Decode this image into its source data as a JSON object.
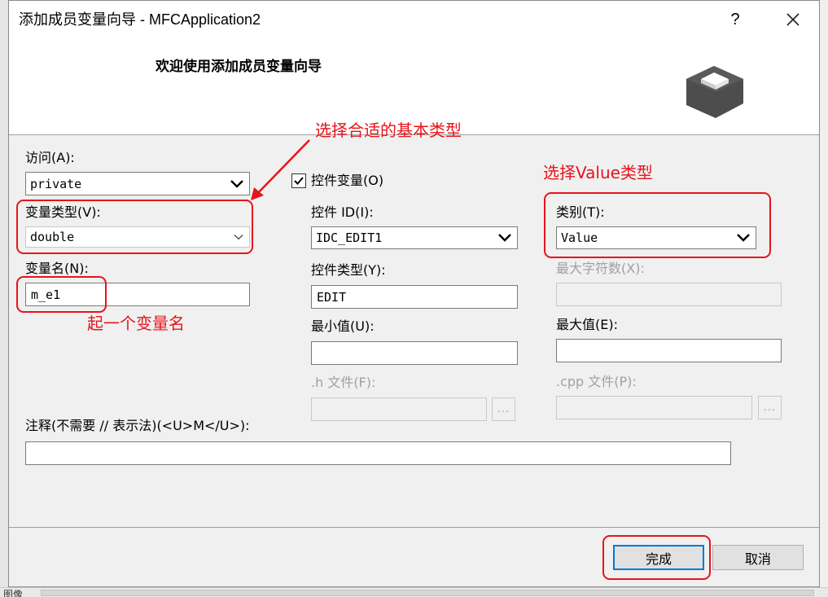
{
  "window": {
    "title": "添加成员变量向导 - MFCApplication2",
    "help_glyph": "?",
    "close_glyph": "✕"
  },
  "banner": {
    "heading": "欢迎使用添加成员变量向导"
  },
  "form": {
    "access_label": "访问(A):",
    "access_value": "private",
    "vartype_label": "变量类型(V):",
    "vartype_value": "double",
    "varname_label": "变量名(N):",
    "varname_value": "m_e1",
    "control_var_label": "控件变量(O)",
    "control_var_checked": true,
    "control_id_label": "控件 ID(I):",
    "control_id_value": "IDC_EDIT1",
    "control_type_label": "控件类型(Y):",
    "control_type_value": "EDIT",
    "min_label": "最小值(U):",
    "min_value": "",
    "h_file_label": ".h 文件(F):",
    "h_file_value": "",
    "category_label": "类别(T):",
    "category_value": "Value",
    "max_chars_label": "最大字符数(X):",
    "max_chars_value": "",
    "max_label": "最大值(E):",
    "max_value": "",
    "cpp_file_label": ".cpp 文件(P):",
    "cpp_file_value": "",
    "browse_label": "...",
    "comment_label": "注释(不需要 // 表示法)(<U>M</U>):",
    "comment_value": ""
  },
  "buttons": {
    "finish": "完成",
    "cancel": "取消"
  },
  "annotations": {
    "choose_basic_type": "选择合适的基本类型",
    "choose_value_type": "选择Value类型",
    "name_variable": "起一个变量名",
    "color": "#e8131b"
  },
  "bottom_strip": {
    "partial_text": "图像"
  }
}
